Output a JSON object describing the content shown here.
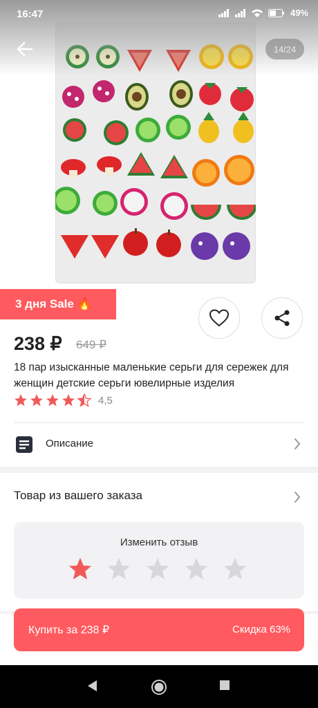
{
  "status": {
    "time": "16:47",
    "battery": "49%"
  },
  "gallery": {
    "counter": "14/24"
  },
  "sale_badge": "3 дня Sale 🔥",
  "price": {
    "current": "238 ₽",
    "old": "649 ₽"
  },
  "product_title": "18 пар изысканные маленькие серьги для сережек для женщин детские серьги ювелирные изделия",
  "rating": {
    "value": "4,5",
    "stars": 4.5
  },
  "description": {
    "label": "Описание"
  },
  "order": {
    "title": "Товар из вашего заказа"
  },
  "review": {
    "label": "Изменить отзыв",
    "selected": 1,
    "total": 5
  },
  "buy": {
    "label": "Купить за 238 ₽",
    "discount": "Скидка 63%"
  },
  "colors": {
    "accent": "#ff5a5f",
    "star": "#f25a5a",
    "star_empty": "#d8d8dc"
  },
  "icons": [
    "arrow-left-icon",
    "heart-icon",
    "share-icon",
    "document-icon",
    "chevron-right-icon",
    "star-icon",
    "back-triangle-icon",
    "home-circle-icon",
    "recents-square-icon"
  ]
}
